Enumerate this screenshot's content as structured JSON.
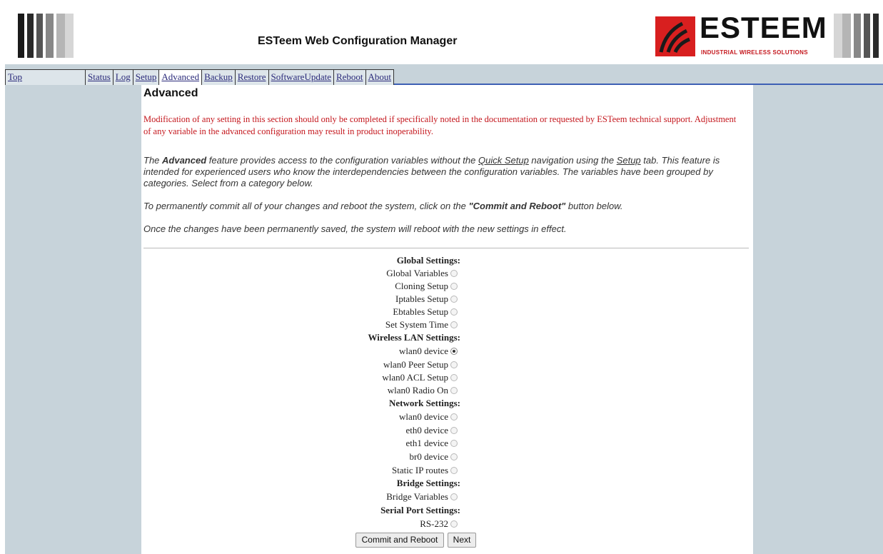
{
  "header": {
    "title": "ESTeem Web Configuration Manager",
    "logo_text": "ESTEEM",
    "logo_tagline": "INDUSTRIAL WIRELESS SOLUTIONS",
    "brand_red": "#d81f1f"
  },
  "nav": {
    "top": "Top",
    "items": [
      "Status",
      "Log",
      "Setup",
      "Advanced",
      "Backup",
      "Restore",
      "SoftwareUpdate",
      "Reboot",
      "About"
    ],
    "active": "Advanced"
  },
  "page": {
    "title": "Advanced",
    "warning": "Modification of any setting in this section should only be completed if specifically noted in the documentation or requested by ESTeem technical support. Adjustment of any variable in the advanced configuration may result in product inoperability.",
    "intro": {
      "t1": "The ",
      "b1": "Advanced",
      "t2": " feature provides access to the configuration variables without the ",
      "u1": "Quick Setup",
      "t3": " navigation using the ",
      "u2": "Setup",
      "t4": " tab. This feature is intended for experienced users who know the interdependencies between the configuration variables. The variables have been grouped by categories. Select from a category below."
    },
    "commit_note": {
      "t1": "To permanently commit all of your changes and reboot the system, click on the ",
      "b1": "\"Commit and Reboot\"",
      "t2": " button below."
    },
    "saved_note": "Once the changes have been permanently saved, the system will reboot with the new settings in effect."
  },
  "groups": [
    {
      "title": "Global Settings:",
      "options": [
        "Global Variables",
        "Cloning Setup",
        "Iptables Setup",
        "Ebtables Setup",
        "Set System Time"
      ]
    },
    {
      "title": "Wireless LAN Settings:",
      "options": [
        "wlan0 device",
        "wlan0 Peer Setup",
        "wlan0 ACL Setup",
        "wlan0 Radio On"
      ]
    },
    {
      "title": "Network Settings:",
      "options": [
        "wlan0 device",
        "eth0 device",
        "eth1 device",
        "br0 device",
        "Static IP routes"
      ]
    },
    {
      "title": "Bridge Settings:",
      "options": [
        "Bridge Variables"
      ]
    },
    {
      "title": "Serial Port Settings:",
      "options": [
        "RS-232"
      ]
    }
  ],
  "selected_option": "wlan0 device (Wireless LAN Settings)",
  "buttons": {
    "commit": "Commit and Reboot",
    "next": "Next"
  }
}
